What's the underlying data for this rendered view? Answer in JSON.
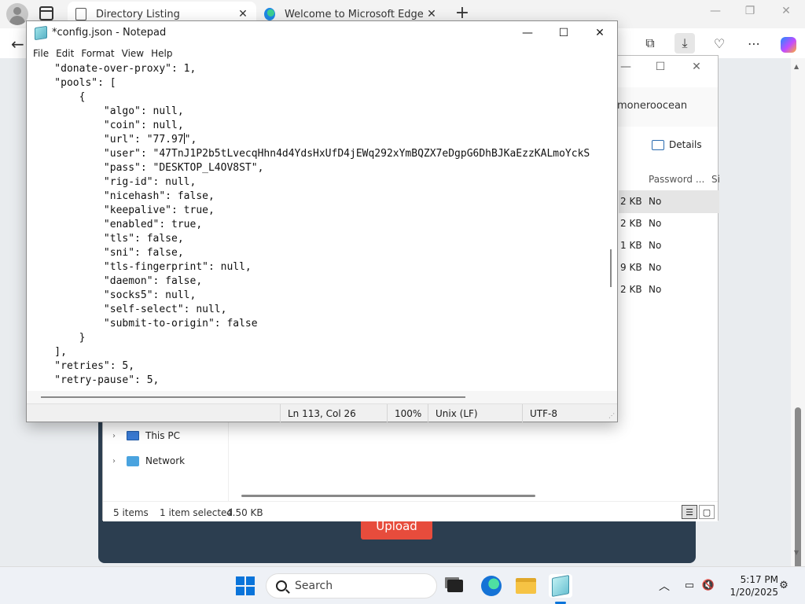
{
  "browser": {
    "tabs": [
      {
        "title": "Directory Listing",
        "favicon": "document-icon"
      },
      {
        "title": "Welcome to Microsoft Edge",
        "favicon": "edge-icon"
      }
    ],
    "toolbar_icons": [
      "collections-icon",
      "downloads-icon",
      "browser-essentials-icon",
      "more-icon",
      "copilot-icon"
    ],
    "upload_button": "Upload"
  },
  "explorer": {
    "address_partial": "moneroocean",
    "details_label": "Details",
    "columns": [
      {
        "label": "Password ..."
      },
      {
        "label": "Si"
      }
    ],
    "rows": [
      {
        "size": "2 KB",
        "password": "No"
      },
      {
        "size": "2 KB",
        "password": "No"
      },
      {
        "size": "1 KB",
        "password": "No"
      },
      {
        "size": "9 KB",
        "password": "No"
      },
      {
        "size": "2 KB",
        "password": "No"
      }
    ],
    "nav": [
      {
        "label": "This PC",
        "icon": "computer-icon"
      },
      {
        "label": "Network",
        "icon": "network-icon"
      }
    ],
    "status": {
      "items": "5 items",
      "selected": "1 item selected",
      "size": "4.50 KB"
    }
  },
  "notepad": {
    "title": "*config.json - Notepad",
    "menu": [
      "File",
      "Edit",
      "Format",
      "View",
      "Help"
    ],
    "lines_before_caret": "    \"donate-over-proxy\": 1,\n    \"pools\": [\n        {\n            \"algo\": null,\n            \"coin\": null,\n            \"url\": \"77.97",
    "lines_after_caret": "\",\n            \"user\": \"47TnJ1P2b5tLvecqHhn4d4YdsHxUfD4jEWq292xYmBQZX7eDgpG6DhBJKaEzzKALmoYckS\n            \"pass\": \"DESKTOP_L4OV8ST\",\n            \"rig-id\": null,\n            \"nicehash\": false,\n            \"keepalive\": true,\n            \"enabled\": true,\n            \"tls\": false,\n            \"sni\": false,\n            \"tls-fingerprint\": null,\n            \"daemon\": false,\n            \"socks5\": null,\n            \"self-select\": null,\n            \"submit-to-origin\": false\n        }\n    ],\n    \"retries\": 5,\n    \"retry-pause\": 5,",
    "status": {
      "position": "Ln 113, Col 26",
      "zoom": "100%",
      "line_ending": "Unix (LF)",
      "encoding": "UTF-8"
    }
  },
  "taskbar": {
    "search_placeholder": "Search",
    "apps": [
      "task-view-icon",
      "edge-icon",
      "file-explorer-icon",
      "notepad-icon"
    ],
    "time": "5:17 PM",
    "date": "1/20/2025"
  }
}
